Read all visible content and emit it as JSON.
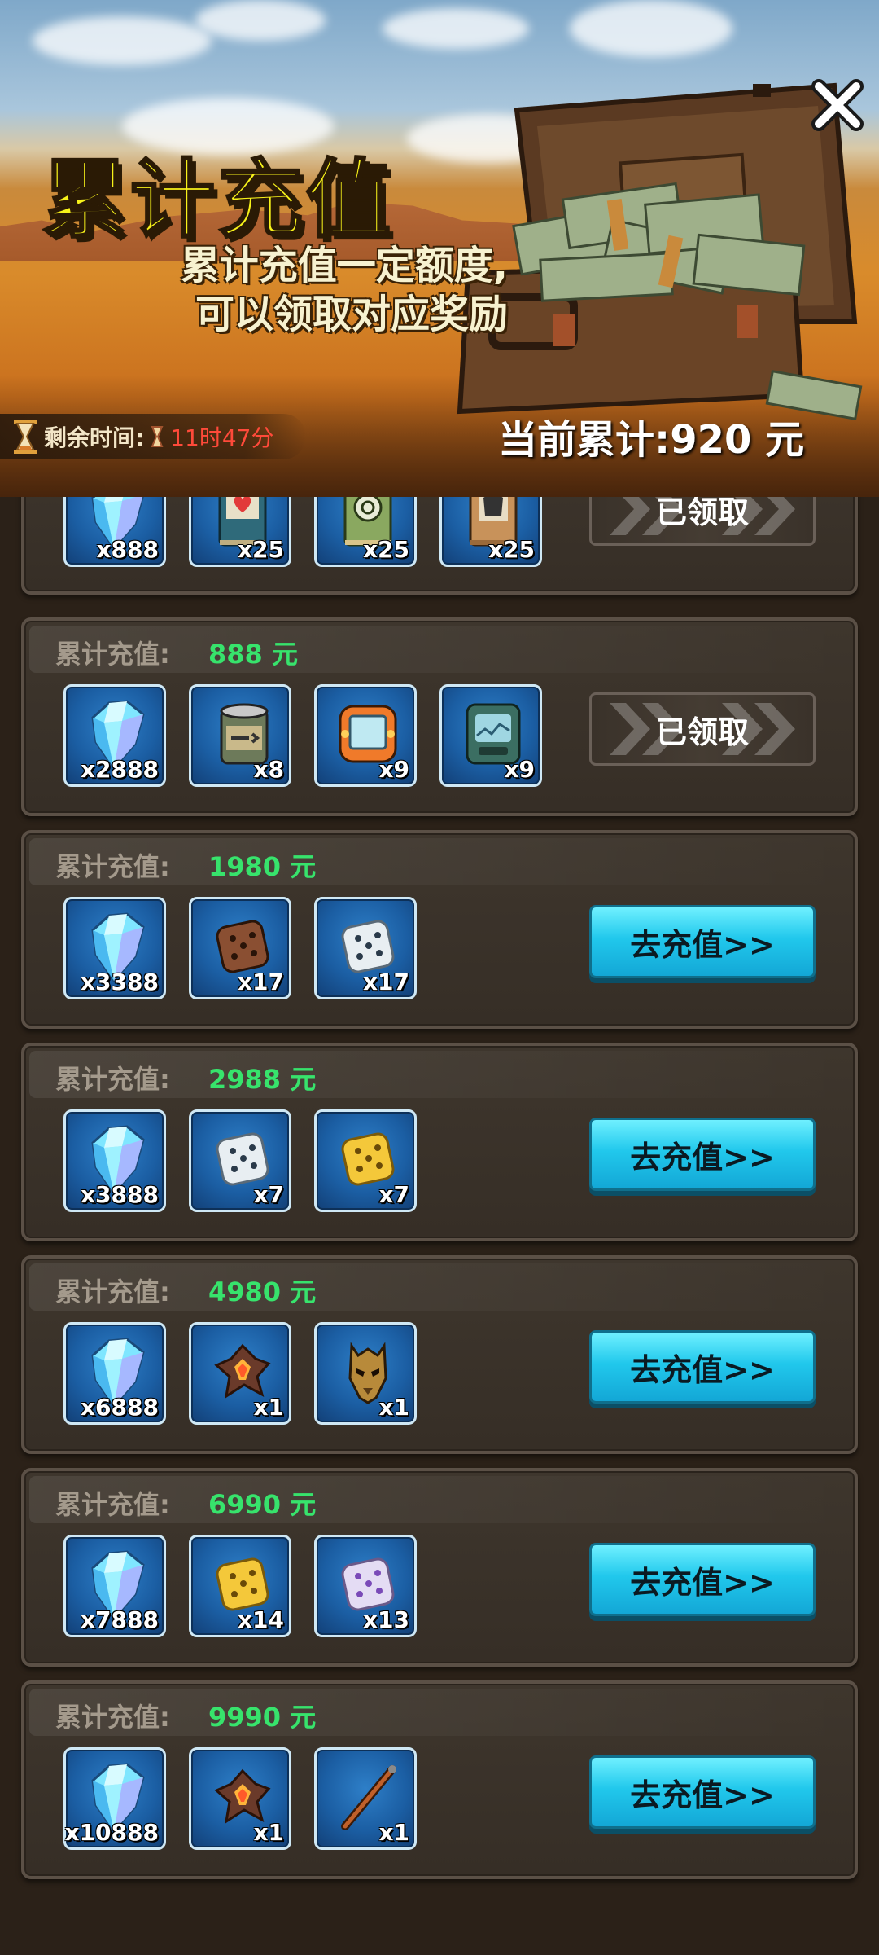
{
  "header": {
    "title": "累计充值",
    "subtitle_line1": "累计充值一定额度,",
    "subtitle_line2": "可以领取对应奖励",
    "timer_label": "剩余时间:",
    "timer_value": "11时47分",
    "total_label": "当前累计:",
    "total_value": "920 元",
    "close_icon": "close-icon"
  },
  "tier_label": "累计充值:",
  "tiers": [
    {
      "threshold": "",
      "button": "已领取",
      "state": "claimed",
      "items": [
        {
          "icon": "diamond-icon",
          "qty": "x888"
        },
        {
          "icon": "heart-book-icon",
          "qty": "x25"
        },
        {
          "icon": "target-book-icon",
          "qty": "x25"
        },
        {
          "icon": "armor-book-icon",
          "qty": "x25"
        }
      ]
    },
    {
      "threshold": "888 元",
      "button": "已领取",
      "state": "claimed",
      "items": [
        {
          "icon": "diamond-icon",
          "qty": "x2888"
        },
        {
          "icon": "fish-can-icon",
          "qty": "x8"
        },
        {
          "icon": "orange-screen-device-icon",
          "qty": "x9"
        },
        {
          "icon": "green-radar-device-icon",
          "qty": "x9"
        }
      ]
    },
    {
      "threshold": "1980 元",
      "button": "去充值>>",
      "state": "go",
      "items": [
        {
          "icon": "diamond-icon",
          "qty": "x3388"
        },
        {
          "icon": "brown-dice-icon",
          "qty": "x17"
        },
        {
          "icon": "white-dice-icon",
          "qty": "x17"
        }
      ]
    },
    {
      "threshold": "2988 元",
      "button": "去充值>>",
      "state": "go",
      "items": [
        {
          "icon": "diamond-icon",
          "qty": "x3888"
        },
        {
          "icon": "white-dice-icon",
          "qty": "x7"
        },
        {
          "icon": "gold-dice-icon",
          "qty": "x7"
        }
      ]
    },
    {
      "threshold": "4980 元",
      "button": "去充值>>",
      "state": "go",
      "items": [
        {
          "icon": "diamond-icon",
          "qty": "x6888"
        },
        {
          "icon": "fire-crystal-icon",
          "qty": "x1"
        },
        {
          "icon": "gold-mask-icon",
          "qty": "x1"
        }
      ]
    },
    {
      "threshold": "6990 元",
      "button": "去充值>>",
      "state": "go",
      "items": [
        {
          "icon": "diamond-icon",
          "qty": "x7888"
        },
        {
          "icon": "gold-dice-icon",
          "qty": "x14"
        },
        {
          "icon": "purple-dice-icon",
          "qty": "x13"
        }
      ]
    },
    {
      "threshold": "9990 元",
      "button": "去充值>>",
      "state": "go",
      "items": [
        {
          "icon": "diamond-icon",
          "qty": "x10888"
        },
        {
          "icon": "fire-crystal-icon",
          "qty": "x1"
        },
        {
          "icon": "staff-icon",
          "qty": "x1"
        }
      ]
    }
  ],
  "colors": {
    "title": "#f7f21a",
    "threshold_green": "#37e36c",
    "timer_red": "#ff4a3a",
    "go_button": "#21c8ec",
    "card_bg": "#3a3229"
  }
}
